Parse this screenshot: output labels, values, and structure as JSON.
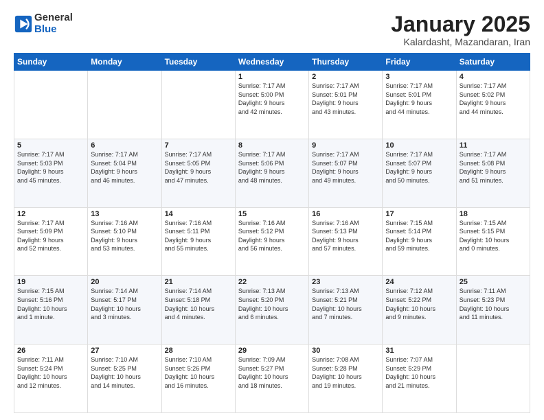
{
  "logo": {
    "general": "General",
    "blue": "Blue"
  },
  "title": "January 2025",
  "subtitle": "Kalardasht, Mazandaran, Iran",
  "weekdays": [
    "Sunday",
    "Monday",
    "Tuesday",
    "Wednesday",
    "Thursday",
    "Friday",
    "Saturday"
  ],
  "weeks": [
    [
      {
        "day": "",
        "info": ""
      },
      {
        "day": "",
        "info": ""
      },
      {
        "day": "",
        "info": ""
      },
      {
        "day": "1",
        "info": "Sunrise: 7:17 AM\nSunset: 5:00 PM\nDaylight: 9 hours\nand 42 minutes."
      },
      {
        "day": "2",
        "info": "Sunrise: 7:17 AM\nSunset: 5:01 PM\nDaylight: 9 hours\nand 43 minutes."
      },
      {
        "day": "3",
        "info": "Sunrise: 7:17 AM\nSunset: 5:01 PM\nDaylight: 9 hours\nand 44 minutes."
      },
      {
        "day": "4",
        "info": "Sunrise: 7:17 AM\nSunset: 5:02 PM\nDaylight: 9 hours\nand 44 minutes."
      }
    ],
    [
      {
        "day": "5",
        "info": "Sunrise: 7:17 AM\nSunset: 5:03 PM\nDaylight: 9 hours\nand 45 minutes."
      },
      {
        "day": "6",
        "info": "Sunrise: 7:17 AM\nSunset: 5:04 PM\nDaylight: 9 hours\nand 46 minutes."
      },
      {
        "day": "7",
        "info": "Sunrise: 7:17 AM\nSunset: 5:05 PM\nDaylight: 9 hours\nand 47 minutes."
      },
      {
        "day": "8",
        "info": "Sunrise: 7:17 AM\nSunset: 5:06 PM\nDaylight: 9 hours\nand 48 minutes."
      },
      {
        "day": "9",
        "info": "Sunrise: 7:17 AM\nSunset: 5:07 PM\nDaylight: 9 hours\nand 49 minutes."
      },
      {
        "day": "10",
        "info": "Sunrise: 7:17 AM\nSunset: 5:07 PM\nDaylight: 9 hours\nand 50 minutes."
      },
      {
        "day": "11",
        "info": "Sunrise: 7:17 AM\nSunset: 5:08 PM\nDaylight: 9 hours\nand 51 minutes."
      }
    ],
    [
      {
        "day": "12",
        "info": "Sunrise: 7:17 AM\nSunset: 5:09 PM\nDaylight: 9 hours\nand 52 minutes."
      },
      {
        "day": "13",
        "info": "Sunrise: 7:16 AM\nSunset: 5:10 PM\nDaylight: 9 hours\nand 53 minutes."
      },
      {
        "day": "14",
        "info": "Sunrise: 7:16 AM\nSunset: 5:11 PM\nDaylight: 9 hours\nand 55 minutes."
      },
      {
        "day": "15",
        "info": "Sunrise: 7:16 AM\nSunset: 5:12 PM\nDaylight: 9 hours\nand 56 minutes."
      },
      {
        "day": "16",
        "info": "Sunrise: 7:16 AM\nSunset: 5:13 PM\nDaylight: 9 hours\nand 57 minutes."
      },
      {
        "day": "17",
        "info": "Sunrise: 7:15 AM\nSunset: 5:14 PM\nDaylight: 9 hours\nand 59 minutes."
      },
      {
        "day": "18",
        "info": "Sunrise: 7:15 AM\nSunset: 5:15 PM\nDaylight: 10 hours\nand 0 minutes."
      }
    ],
    [
      {
        "day": "19",
        "info": "Sunrise: 7:15 AM\nSunset: 5:16 PM\nDaylight: 10 hours\nand 1 minute."
      },
      {
        "day": "20",
        "info": "Sunrise: 7:14 AM\nSunset: 5:17 PM\nDaylight: 10 hours\nand 3 minutes."
      },
      {
        "day": "21",
        "info": "Sunrise: 7:14 AM\nSunset: 5:18 PM\nDaylight: 10 hours\nand 4 minutes."
      },
      {
        "day": "22",
        "info": "Sunrise: 7:13 AM\nSunset: 5:20 PM\nDaylight: 10 hours\nand 6 minutes."
      },
      {
        "day": "23",
        "info": "Sunrise: 7:13 AM\nSunset: 5:21 PM\nDaylight: 10 hours\nand 7 minutes."
      },
      {
        "day": "24",
        "info": "Sunrise: 7:12 AM\nSunset: 5:22 PM\nDaylight: 10 hours\nand 9 minutes."
      },
      {
        "day": "25",
        "info": "Sunrise: 7:11 AM\nSunset: 5:23 PM\nDaylight: 10 hours\nand 11 minutes."
      }
    ],
    [
      {
        "day": "26",
        "info": "Sunrise: 7:11 AM\nSunset: 5:24 PM\nDaylight: 10 hours\nand 12 minutes."
      },
      {
        "day": "27",
        "info": "Sunrise: 7:10 AM\nSunset: 5:25 PM\nDaylight: 10 hours\nand 14 minutes."
      },
      {
        "day": "28",
        "info": "Sunrise: 7:10 AM\nSunset: 5:26 PM\nDaylight: 10 hours\nand 16 minutes."
      },
      {
        "day": "29",
        "info": "Sunrise: 7:09 AM\nSunset: 5:27 PM\nDaylight: 10 hours\nand 18 minutes."
      },
      {
        "day": "30",
        "info": "Sunrise: 7:08 AM\nSunset: 5:28 PM\nDaylight: 10 hours\nand 19 minutes."
      },
      {
        "day": "31",
        "info": "Sunrise: 7:07 AM\nSunset: 5:29 PM\nDaylight: 10 hours\nand 21 minutes."
      },
      {
        "day": "",
        "info": ""
      }
    ]
  ]
}
